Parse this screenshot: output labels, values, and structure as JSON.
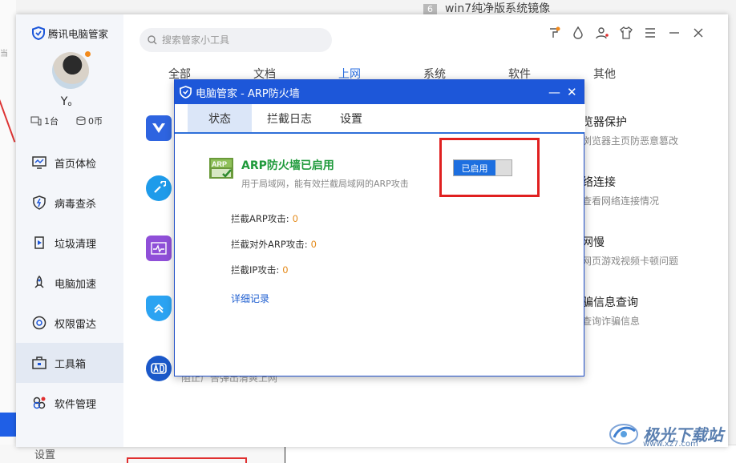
{
  "background": {
    "top_badge": "6",
    "top_text": "win7纯净版系统镜像",
    "bottom_settings": "设置"
  },
  "app": {
    "brand": "腾讯电脑管家",
    "username": "Y。",
    "stats": {
      "devices": "1台",
      "coins": "0币"
    },
    "nav": [
      {
        "label": "首页体检",
        "icon": "monitor-icon"
      },
      {
        "label": "病毒查杀",
        "icon": "shield-bolt-icon"
      },
      {
        "label": "垃圾清理",
        "icon": "broom-icon"
      },
      {
        "label": "电脑加速",
        "icon": "rocket-icon"
      },
      {
        "label": "权限雷达",
        "icon": "radar-icon"
      },
      {
        "label": "工具箱",
        "icon": "toolbox-icon"
      },
      {
        "label": "软件管理",
        "icon": "apps-icon"
      }
    ],
    "active_nav": "工具箱",
    "search_placeholder": "搜索管家小工具",
    "category_tabs": [
      "全部",
      "文档",
      "上网",
      "系统",
      "软件",
      "其他"
    ],
    "active_category": "上网",
    "right_tools": [
      {
        "title": "览器保护",
        "desc": "浏览器主页防恶意篡改"
      },
      {
        "title": "络连接",
        "desc": "查看网络连接情况"
      },
      {
        "title": "网慢",
        "desc": "网页游戏视频卡顿问题"
      },
      {
        "title": "骗信息查询",
        "desc": "查询诈骗信息"
      }
    ],
    "partial_text": "阻止广告弹出清爽上网"
  },
  "dialog": {
    "title": "电脑管家 - ARP防火墙",
    "tabs": [
      "状态",
      "拦截日志",
      "设置"
    ],
    "active_tab": "状态",
    "status_title": "ARP防火墙已启用",
    "status_desc": "用于局域网，能有效拦截局域网的ARP攻击",
    "toggle_label": "已启用",
    "stats": [
      {
        "label": "拦截ARP攻击:",
        "value": "0"
      },
      {
        "label": "拦截对外ARP攻击:",
        "value": "0"
      },
      {
        "label": "拦截IP攻击:",
        "value": "0"
      }
    ],
    "detail_link": "详细记录"
  },
  "watermark": {
    "text": "极光下载站",
    "url": "www.xz7.com"
  },
  "colors": {
    "accent": "#1d57d9",
    "green": "#1f9a3b",
    "orange": "#e48a1a",
    "highlight": "#e02020"
  }
}
